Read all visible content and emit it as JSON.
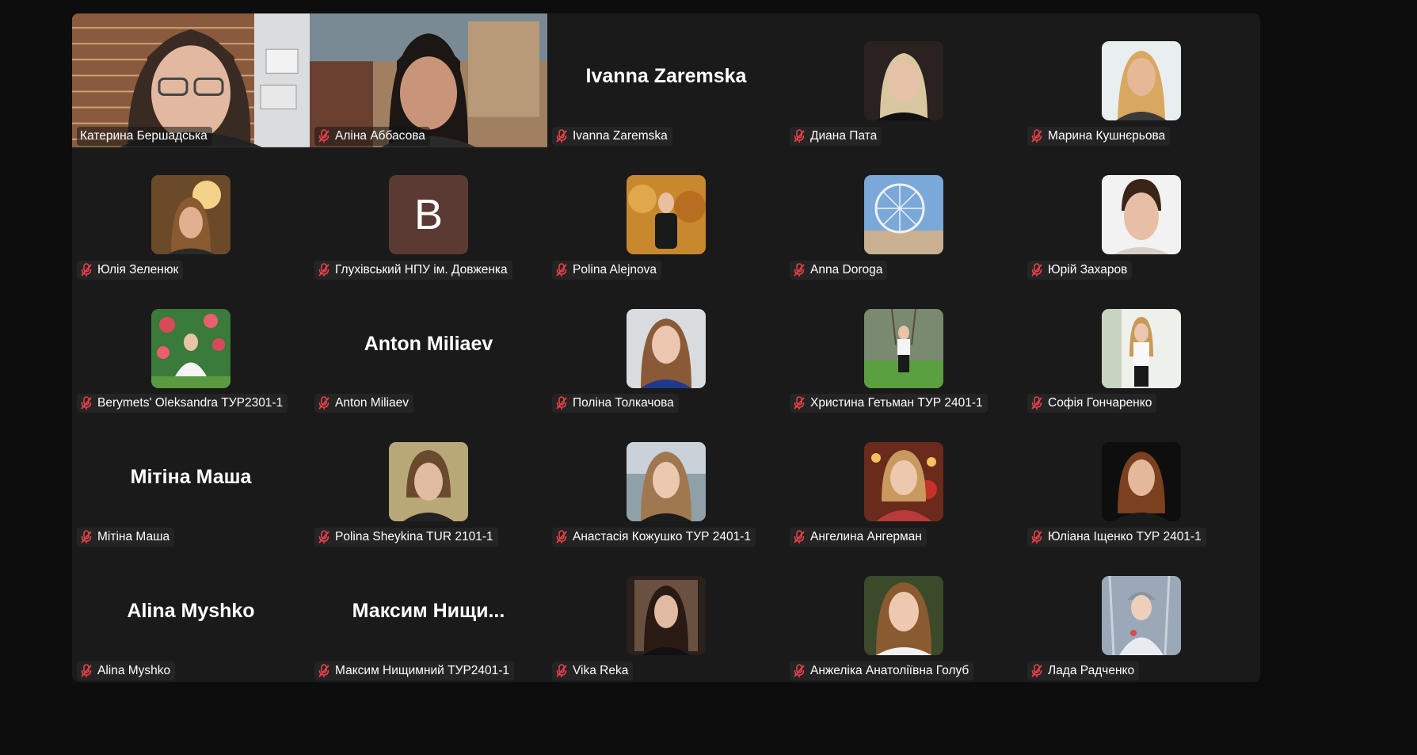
{
  "colors": {
    "speaking_border": "#23d959",
    "muted_icon": "#e8404a",
    "tile_bg": "#1a1a1a",
    "page_bg": "#0d0d0d"
  },
  "participants": [
    {
      "display_name": "Катерина Бершадська",
      "type": "video",
      "speaking": true,
      "muted": false
    },
    {
      "display_name": "Аліна Аббасова",
      "type": "video",
      "speaking": false,
      "muted": true
    },
    {
      "display_name": "Ivanna Zaremska",
      "big_name": "Ivanna Zaremska",
      "type": "name",
      "muted": true
    },
    {
      "display_name": "Диана Пата",
      "type": "avatar",
      "muted": true
    },
    {
      "display_name": "Марина Кушнєрьова",
      "type": "avatar",
      "muted": true
    },
    {
      "display_name": "Юлія Зеленюк",
      "type": "avatar",
      "muted": true
    },
    {
      "display_name": "Глухівський НПУ ім. Довженка",
      "type": "letter",
      "letter": "В",
      "muted": true
    },
    {
      "display_name": "Polina Alejnova",
      "type": "avatar",
      "muted": true
    },
    {
      "display_name": "Anna Doroga",
      "type": "avatar",
      "muted": true
    },
    {
      "display_name": "Юрій Захаров",
      "type": "avatar",
      "muted": true
    },
    {
      "display_name": "Berymets' Oleksandra ТУР2301-1",
      "type": "avatar",
      "muted": true
    },
    {
      "display_name": "Anton Miliaev",
      "big_name": "Anton Miliaev",
      "type": "name",
      "muted": true
    },
    {
      "display_name": "Поліна Толкачова",
      "type": "avatar",
      "muted": true
    },
    {
      "display_name": "Христина Гетьман ТУР 2401-1",
      "type": "avatar",
      "muted": true
    },
    {
      "display_name": "Софія Гончаренко",
      "type": "avatar",
      "muted": true
    },
    {
      "display_name": "Мітіна Маша",
      "big_name": "Мітіна Маша",
      "type": "name",
      "muted": true
    },
    {
      "display_name": "Polina Sheykina TUR 2101-1",
      "type": "avatar",
      "muted": true
    },
    {
      "display_name": "Анастасія Кожушко ТУР 2401-1",
      "type": "avatar",
      "muted": true
    },
    {
      "display_name": "Ангелина Ангерман",
      "type": "avatar",
      "muted": true
    },
    {
      "display_name": "Юліана Іщенко ТУР 2401-1",
      "type": "avatar",
      "muted": true
    },
    {
      "display_name": "Alina Myshko",
      "big_name": "Alina Myshko",
      "type": "name",
      "muted": true
    },
    {
      "display_name": "Максим Нищимний ТУР2401-1",
      "big_name": "Максим  Нищи...",
      "type": "name",
      "muted": true
    },
    {
      "display_name": "Vika Reka",
      "type": "avatar",
      "muted": true
    },
    {
      "display_name": "Анжеліка Анатоліївна Голуб",
      "type": "avatar",
      "muted": true
    },
    {
      "display_name": "Лада Радченко",
      "type": "avatar",
      "muted": true
    }
  ]
}
